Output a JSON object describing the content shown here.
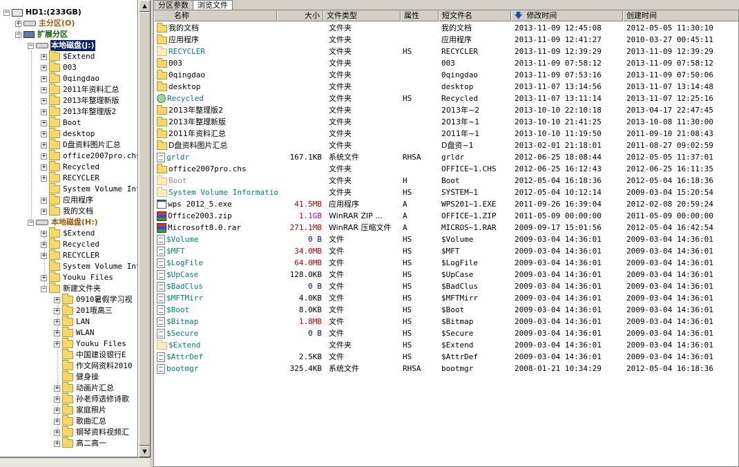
{
  "tabs": [
    {
      "label": "分区参数"
    },
    {
      "label": "浏览文件"
    }
  ],
  "tree": {
    "root": "HD1:(233GB)",
    "primary": "主分区(O)",
    "extended": "扩展分区",
    "disk_j": "本地磁盘(J:)",
    "disk_j_children": [
      "$Extend",
      "003",
      "0qingdao",
      "2011年资料汇总",
      "2013年整理新版",
      "2013年整理版2",
      "Boot",
      "desktop",
      "D盘资料图片汇总",
      "office2007pro.chs",
      "Recycled",
      "RECYCLER",
      "System Volume Inf",
      "应用程序",
      "我的文档"
    ],
    "disk_h": "本地磁盘(H:)",
    "disk_h_children": [
      "$Extend",
      "Recycled",
      "RECYCLER",
      "System Volume Inf",
      "Youku Files",
      "新建文件夹"
    ],
    "new_folder_children": [
      "0910暑假学习视",
      "201哦高三",
      "LAN",
      "WLAN",
      "Youku Files",
      "中国建设银行E",
      "作文网资料2010",
      "健身操",
      "动画片汇总",
      "孙老师选修诗歌",
      "家庭照片",
      "歌曲汇总",
      "钢琴资料视频汇",
      "高二高一"
    ]
  },
  "columns": {
    "name": "名称",
    "size": "大小",
    "type": "文件类型",
    "attr": "属性",
    "short": "短文件名",
    "modified": "修改时间",
    "created": "创建时间"
  },
  "rows": [
    {
      "name": "我的文档",
      "size": "",
      "type": "文件夹",
      "attr": "",
      "short": "我的文档",
      "modified": "2013-11-09 12:45:08",
      "created": "2012-05-05 11:30:10",
      "icon": "folder",
      "color": "",
      "size_color": ""
    },
    {
      "name": "应用程序",
      "size": "",
      "type": "文件夹",
      "attr": "",
      "short": "应用程序",
      "modified": "2013-11-09 12:41:27",
      "created": "2010-03-27 00:45:11",
      "icon": "folder",
      "color": "",
      "size_color": ""
    },
    {
      "name": "RECYCLER",
      "size": "",
      "type": "文件夹",
      "attr": "HS",
      "short": "RECYCLER",
      "modified": "2013-11-09 12:39:29",
      "created": "2013-11-09 12:39:29",
      "icon": "folder-hidden",
      "color": "teal",
      "size_color": ""
    },
    {
      "name": "003",
      "size": "",
      "type": "文件夹",
      "attr": "",
      "short": "003",
      "modified": "2013-11-09 07:58:12",
      "created": "2013-11-09 07:58:12",
      "icon": "folder",
      "color": "",
      "size_color": ""
    },
    {
      "name": "0qingdao",
      "size": "",
      "type": "文件夹",
      "attr": "",
      "short": "0qingdao",
      "modified": "2013-11-09 07:53:16",
      "created": "2013-11-09 07:50:06",
      "icon": "folder",
      "color": "",
      "size_color": ""
    },
    {
      "name": "desktop",
      "size": "",
      "type": "文件夹",
      "attr": "",
      "short": "desktop",
      "modified": "2013-11-07 13:14:56",
      "created": "2013-11-07 13:14:48",
      "icon": "folder",
      "color": "",
      "size_color": ""
    },
    {
      "name": "Recycled",
      "size": "",
      "type": "文件夹",
      "attr": "HS",
      "short": "Recycled",
      "modified": "2013-11-07 13:11:14",
      "created": "2013-11-07 12:25:16",
      "icon": "recycle",
      "color": "teal",
      "size_color": ""
    },
    {
      "name": "2013年整理版2",
      "size": "",
      "type": "文件夹",
      "attr": "",
      "short": "2013年~2",
      "modified": "2013-10-10 22:10:18",
      "created": "2013-04-17 22:47:45",
      "icon": "folder",
      "color": "",
      "size_color": ""
    },
    {
      "name": "2013年整理新版",
      "size": "",
      "type": "文件夹",
      "attr": "",
      "short": "2013年~1",
      "modified": "2013-10-10 21:41:25",
      "created": "2013-10-08 11:30:00",
      "icon": "folder",
      "color": "",
      "size_color": ""
    },
    {
      "name": "2011年资料汇总",
      "size": "",
      "type": "文件夹",
      "attr": "",
      "short": "2011年~1",
      "modified": "2013-10-10 11:19:50",
      "created": "2011-09-10 21:08:43",
      "icon": "folder",
      "color": "",
      "size_color": ""
    },
    {
      "name": "D盘资料图片汇总",
      "size": "",
      "type": "文件夹",
      "attr": "",
      "short": "D盘资~1",
      "modified": "2013-02-01 21:18:01",
      "created": "2011-08-27 09:02:59",
      "icon": "folder",
      "color": "",
      "size_color": ""
    },
    {
      "name": "grldr",
      "size": "167.1KB",
      "type": "系统文件",
      "attr": "RHSA",
      "short": "grldr",
      "modified": "2012-06-25 18:08:44",
      "created": "2012-05-05 11:37:01",
      "icon": "file",
      "color": "teal",
      "size_color": ""
    },
    {
      "name": "office2007pro.chs",
      "size": "",
      "type": "文件夹",
      "attr": "",
      "short": "OFFICE~1.CHS",
      "modified": "2012-06-25 16:12:43",
      "created": "2012-06-25 16:11:35",
      "icon": "folder",
      "color": "",
      "size_color": ""
    },
    {
      "name": "Boot",
      "size": "",
      "type": "文件夹",
      "attr": "H",
      "short": "Boot",
      "modified": "2012-05-04 16:18:36",
      "created": "2012-05-04 16:18:36",
      "icon": "folder-hidden",
      "color": "gray",
      "size_color": ""
    },
    {
      "name": "System Volume Information",
      "size": "",
      "type": "文件夹",
      "attr": "HS",
      "short": "SYSTEM~1",
      "modified": "2012-05-04 10:12:14",
      "created": "2009-03-04 15:20:54",
      "icon": "folder-hidden",
      "color": "teal",
      "size_color": ""
    },
    {
      "name": "wps 2012_5.exe",
      "size": "41.5MB",
      "type": "应用程序",
      "attr": "A",
      "short": "WPS201~1.EXE",
      "modified": "2011-09-26 16:39:04",
      "created": "2012-02-08 20:59:24",
      "icon": "exe",
      "color": "",
      "size_color": "red"
    },
    {
      "name": "Office2003.zip",
      "size": "1.1GB",
      "type": "WinRAR ZIP ...",
      "attr": "A",
      "short": "OFFICE~1.ZIP",
      "modified": "2011-05-09 00:00:00",
      "created": "2011-05-09 00:00:00",
      "icon": "rar",
      "color": "",
      "size_color": "mag"
    },
    {
      "name": "Microsoft8.0.rar",
      "size": "271.1MB",
      "type": "WinRAR 压缩文件",
      "attr": "A",
      "short": "MICROS~1.RAR",
      "modified": "2009-09-17 15:01:56",
      "created": "2012-05-04 16:42:54",
      "icon": "rar",
      "color": "",
      "size_color": "red"
    },
    {
      "name": "$Volume",
      "size": "0 B",
      "type": "文件",
      "attr": "HS",
      "short": "$Volume",
      "modified": "2009-03-04 14:36:01",
      "created": "2009-03-04 14:36:01",
      "icon": "file",
      "color": "teal",
      "size_color": "blue"
    },
    {
      "name": "$MFT",
      "size": "34.0MB",
      "type": "文件",
      "attr": "HS",
      "short": "$MFT",
      "modified": "2009-03-04 14:36:01",
      "created": "2009-03-04 14:36:01",
      "icon": "file",
      "color": "teal",
      "size_color": "red"
    },
    {
      "name": "$LogFile",
      "size": "64.0MB",
      "type": "文件",
      "attr": "HS",
      "short": "$LogFile",
      "modified": "2009-03-04 14:36:01",
      "created": "2009-03-04 14:36:01",
      "icon": "file",
      "color": "teal",
      "size_color": "red"
    },
    {
      "name": "$UpCase",
      "size": "128.0KB",
      "type": "文件",
      "attr": "HS",
      "short": "$UpCase",
      "modified": "2009-03-04 14:36:01",
      "created": "2009-03-04 14:36:01",
      "icon": "file",
      "color": "teal",
      "size_color": ""
    },
    {
      "name": "$BadClus",
      "size": "0 B",
      "type": "文件",
      "attr": "HS",
      "short": "$BadClus",
      "modified": "2009-03-04 14:36:01",
      "created": "2009-03-04 14:36:01",
      "icon": "file",
      "color": "teal",
      "size_color": "blue"
    },
    {
      "name": "$MFTMirr",
      "size": "4.0KB",
      "type": "文件",
      "attr": "HS",
      "short": "$MFTMirr",
      "modified": "2009-03-04 14:36:01",
      "created": "2009-03-04 14:36:01",
      "icon": "file",
      "color": "teal",
      "size_color": ""
    },
    {
      "name": "$Boot",
      "size": "8.0KB",
      "type": "文件",
      "attr": "HS",
      "short": "$Boot",
      "modified": "2009-03-04 14:36:01",
      "created": "2009-03-04 14:36:01",
      "icon": "file",
      "color": "teal",
      "size_color": ""
    },
    {
      "name": "$Bitmap",
      "size": "1.8MB",
      "type": "文件",
      "attr": "HS",
      "short": "$Bitmap",
      "modified": "2009-03-04 14:36:01",
      "created": "2009-03-04 14:36:01",
      "icon": "file",
      "color": "teal",
      "size_color": "red"
    },
    {
      "name": "$Secure",
      "size": "0 B",
      "type": "文件",
      "attr": "HS",
      "short": "$Secure",
      "modified": "2009-03-04 14:36:01",
      "created": "2009-03-04 14:36:01",
      "icon": "file",
      "color": "teal",
      "size_color": "blue"
    },
    {
      "name": "$Extend",
      "size": "",
      "type": "文件夹",
      "attr": "HS",
      "short": "$Extend",
      "modified": "2009-03-04 14:36:01",
      "created": "2009-03-04 14:36:01",
      "icon": "folder-hidden",
      "color": "teal",
      "size_color": ""
    },
    {
      "name": "$AttrDef",
      "size": "2.5KB",
      "type": "文件",
      "attr": "HS",
      "short": "$AttrDef",
      "modified": "2009-03-04 14:36:01",
      "created": "2009-03-04 14:36:01",
      "icon": "file",
      "color": "teal",
      "size_color": ""
    },
    {
      "name": "bootmgr",
      "size": "325.4KB",
      "type": "系统文件",
      "attr": "RHSA",
      "short": "bootmgr",
      "modified": "2008-01-21 10:34:29",
      "created": "2012-05-04 16:18:36",
      "icon": "file",
      "color": "teal",
      "size_color": ""
    }
  ]
}
